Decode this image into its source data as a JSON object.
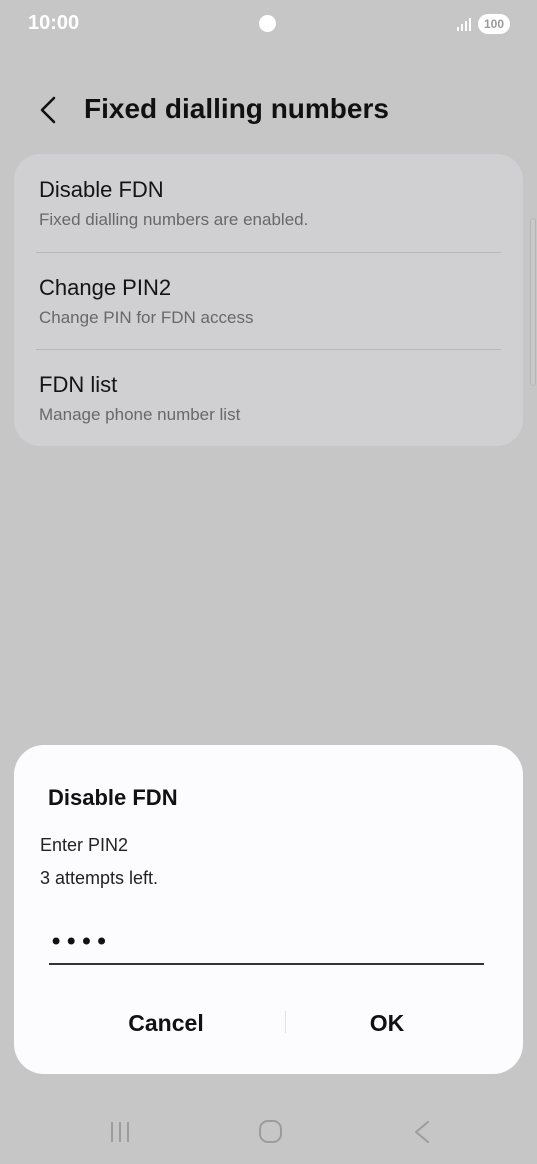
{
  "status_bar": {
    "time": "10:00",
    "battery_level": "100",
    "icons": [
      "camera-dot",
      "signal-icon",
      "battery-icon"
    ]
  },
  "header": {
    "title": "Fixed dialling numbers",
    "back_icon": "back-arrow-icon"
  },
  "settings": {
    "items": [
      {
        "title": "Disable FDN",
        "subtitle": "Fixed dialling numbers are enabled."
      },
      {
        "title": "Change PIN2",
        "subtitle": "Change PIN for FDN access"
      },
      {
        "title": "FDN list",
        "subtitle": "Manage phone number list"
      }
    ]
  },
  "dialog": {
    "title": "Disable FDN",
    "message_line1": "Enter PIN2",
    "message_line2": "3 attempts left.",
    "pin_value": "1234",
    "cancel_label": "Cancel",
    "ok_label": "OK"
  },
  "nav_bar": {
    "icons": [
      "recents-icon",
      "home-icon",
      "back-icon"
    ]
  },
  "colors": {
    "scrim": "#c6c6c6",
    "card": "#d0d0d2",
    "dialog": "#fcfcfe",
    "text_primary": "#141414",
    "text_secondary": "#686868"
  }
}
